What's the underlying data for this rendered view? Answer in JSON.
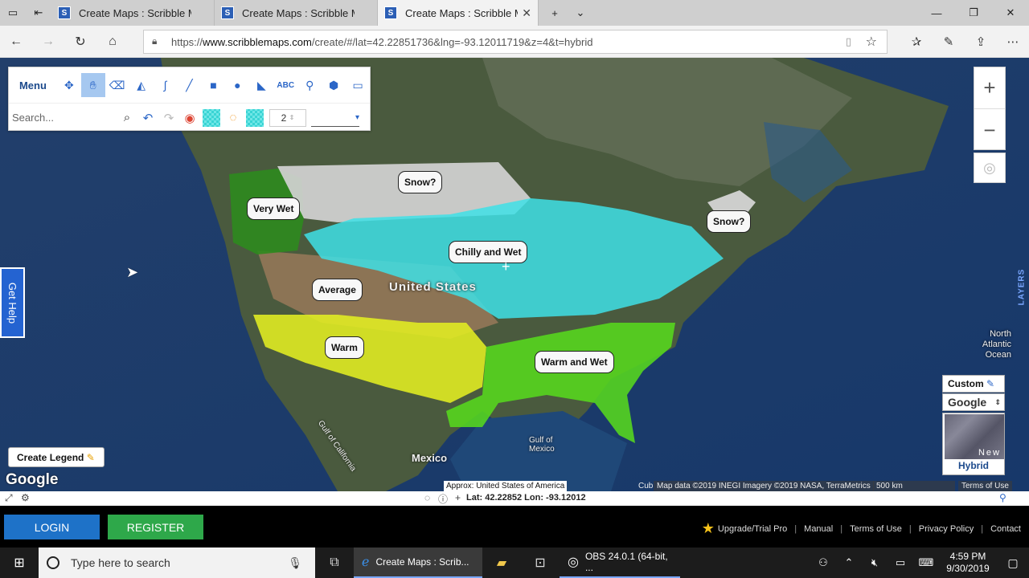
{
  "browser": {
    "tabs": [
      {
        "label": "Create Maps : Scribble Map"
      },
      {
        "label": "Create Maps : Scribble Map"
      },
      {
        "label": "Create Maps : Scribble M"
      }
    ],
    "url_prefix": "https://",
    "url_domain": "www.scribblemaps.com",
    "url_rest": "/create/#/lat=42.22851736&lng=-93.12011719&z=4&t=hybrid"
  },
  "toolbar": {
    "menu_label": "Menu",
    "search_placeholder": "Search...",
    "line_width": "2",
    "text_tool": "ABC"
  },
  "map": {
    "labels": [
      {
        "text": "Very Wet"
      },
      {
        "text": "Snow?"
      },
      {
        "text": "Snow?"
      },
      {
        "text": "Chilly and Wet"
      },
      {
        "text": "Average"
      },
      {
        "text": "Warm"
      },
      {
        "text": "Warm and Wet"
      }
    ],
    "places": {
      "us": "United States",
      "mexico": "Mexico",
      "gulf_mexico": "Gulf of Mexico",
      "gulf_california": "Gulf of California",
      "atlantic": "North Atlantic Ocean"
    },
    "get_help": "Get Help",
    "layers": "LAYERS",
    "create_legend": "Create Legend",
    "google": "Google",
    "custom": "Custom",
    "provider": "Google",
    "thumb_text": "New",
    "thumb_caption": "Hybrid",
    "approx": "Approx: United States of America",
    "attribution": "Map data ©2019 INEGI Imagery ©2019 NASA, TerraMetrics",
    "scale": "500 km",
    "terms": "Terms of Use",
    "cuba": "Cub"
  },
  "status": {
    "coords": "Lat: 42.22852 Lon: -93.12012"
  },
  "appbar": {
    "login": "LOGIN",
    "register": "REGISTER",
    "upgrade": "Upgrade/Trial Pro",
    "manual": "Manual",
    "terms": "Terms of Use",
    "privacy": "Privacy Policy",
    "contact": "Contact"
  },
  "taskbar": {
    "search_placeholder": "Type here to search",
    "edge_app": "Create Maps : Scrib...",
    "obs_app": "OBS 24.0.1 (64-bit, ...",
    "time": "4:59 PM",
    "date": "9/30/2019"
  }
}
